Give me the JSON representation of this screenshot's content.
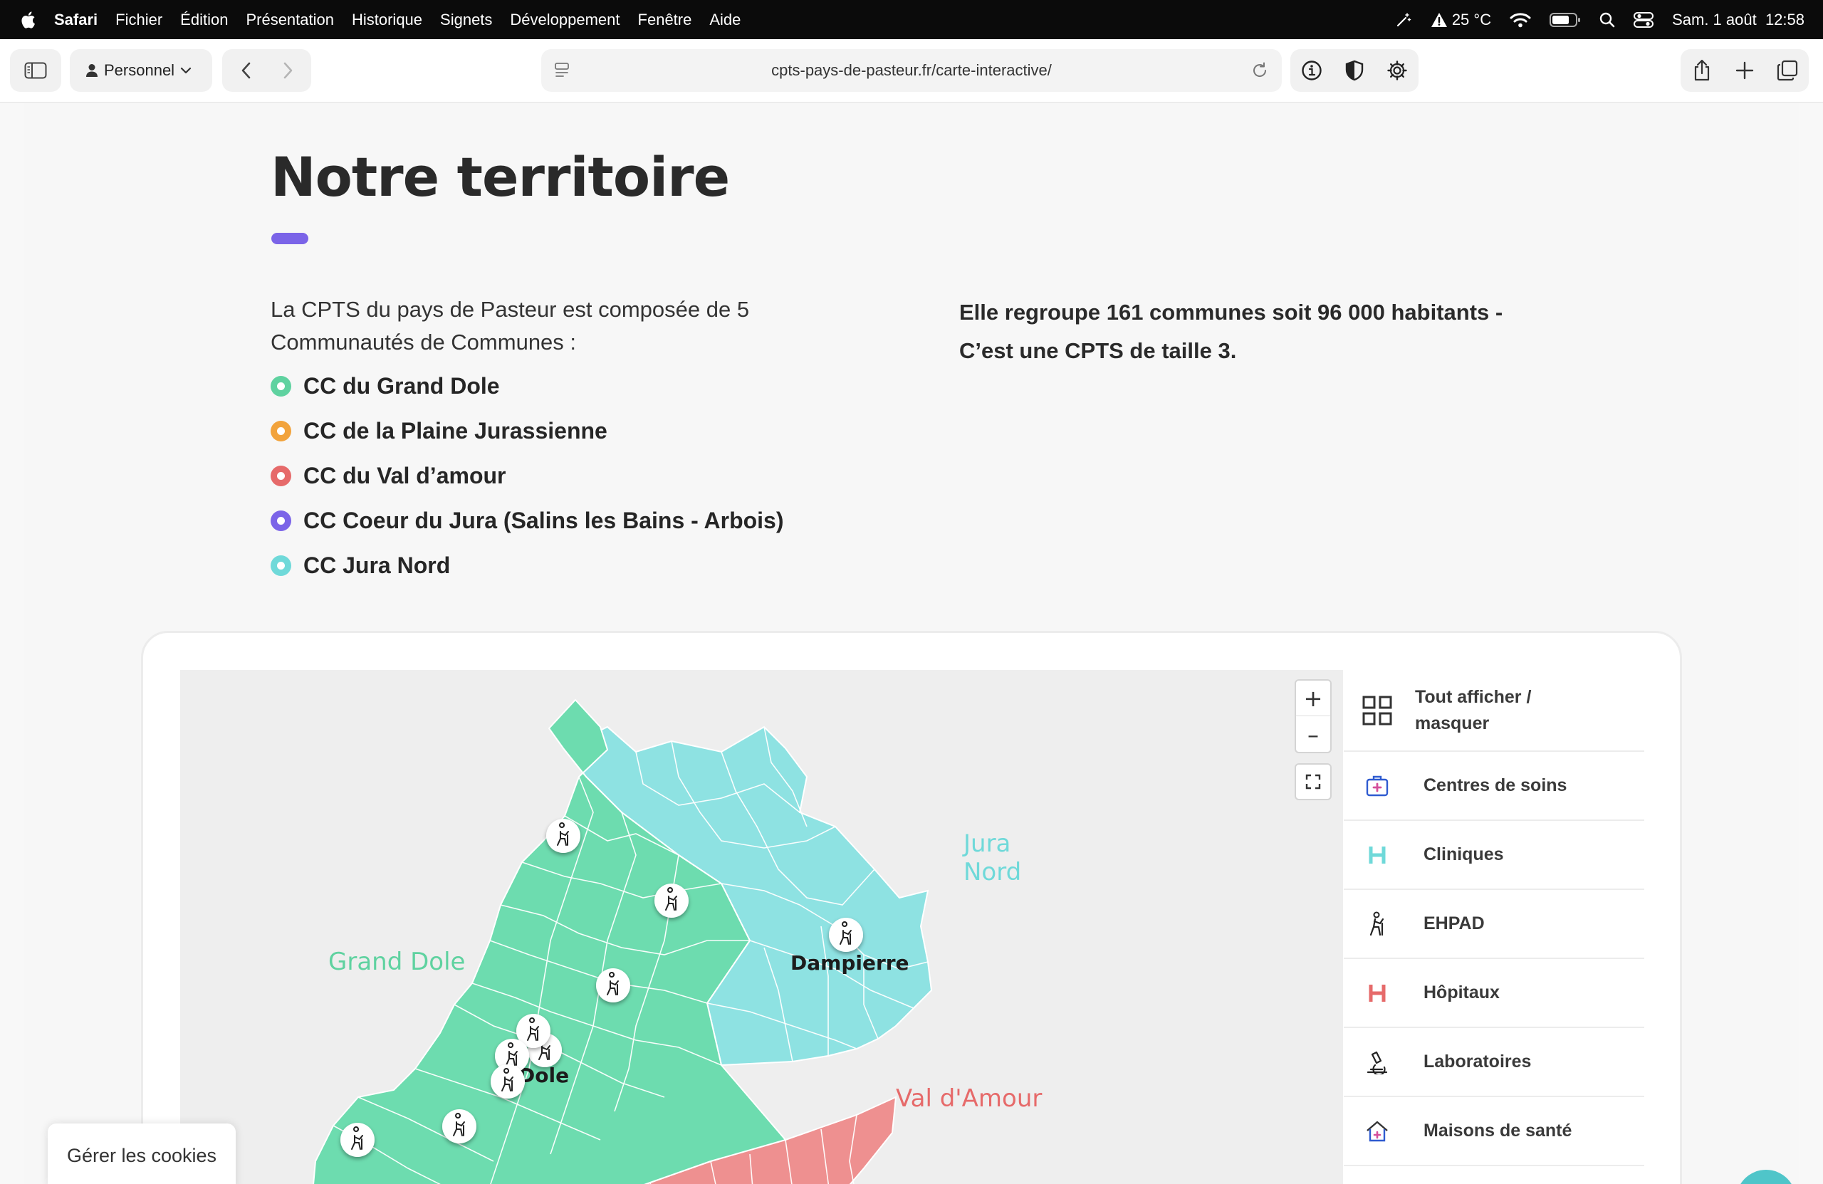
{
  "menubar": {
    "app_name": "Safari",
    "items": [
      "Fichier",
      "Édition",
      "Présentation",
      "Historique",
      "Signets",
      "Développement",
      "Fenêtre",
      "Aide"
    ],
    "weather": "25 °C",
    "datetime": "Sam. 1 août  12:58",
    "battery_level": 0.75
  },
  "toolbar": {
    "profile_label": "Personnel",
    "url": "cpts-pays-de-pasteur.fr/carte-interactive/"
  },
  "page": {
    "title": "Notre territoire",
    "accent_color": "#7b64e8",
    "intro": "La CPTS du pays de Pasteur est composée de 5 Communautés de Communes :",
    "communities": [
      {
        "label": "CC du Grand Dole",
        "color": "#5fd2a0"
      },
      {
        "label": "CC de la Plaine Jurassienne",
        "color": "#f2a33c"
      },
      {
        "label": "CC du Val d’amour",
        "color": "#e66a6a"
      },
      {
        "label": "CC Coeur du Jura (Salins les Bains - Arbois)",
        "color": "#7b64e8"
      },
      {
        "label": "CC Jura Nord",
        "color": "#6fd9d9"
      }
    ],
    "stats_line1": "Elle regroupe 161 communes soit 96 000 habitants -",
    "stats_line2": "C’est une CPTS de taille 3."
  },
  "map": {
    "region_labels": {
      "jura_nord_1": "Jura",
      "jura_nord_2": "Nord",
      "grand_dole": "Grand Dole",
      "val_amour": "Val d'Amour"
    },
    "town_labels": {
      "dampierre": "Dampierre",
      "dole": "Dole"
    },
    "zoom_in": "+",
    "zoom_out": "–",
    "colors": {
      "grand_dole": "#6ddcaf",
      "jura_nord": "#8ee2e2",
      "val_amour": "#ee9090",
      "plaine": "#f2a85a",
      "coeur": "#8a78e6"
    }
  },
  "legend": {
    "items": [
      {
        "label_1": "Tout afficher /",
        "label_2": "masquer",
        "icon": "grid-icon"
      },
      {
        "label": "Centres de soins",
        "icon": "medical-bag-icon"
      },
      {
        "label": "Cliniques",
        "icon": "clinic-h-icon"
      },
      {
        "label": "EHPAD",
        "icon": "elderly-icon"
      },
      {
        "label": "Hôpitaux",
        "icon": "hospital-h-icon"
      },
      {
        "label": "Laboratoires",
        "icon": "microscope-icon"
      },
      {
        "label": "Maisons de santé",
        "icon": "house-health-icon"
      }
    ]
  },
  "cookie_button": "Gérer les cookies"
}
